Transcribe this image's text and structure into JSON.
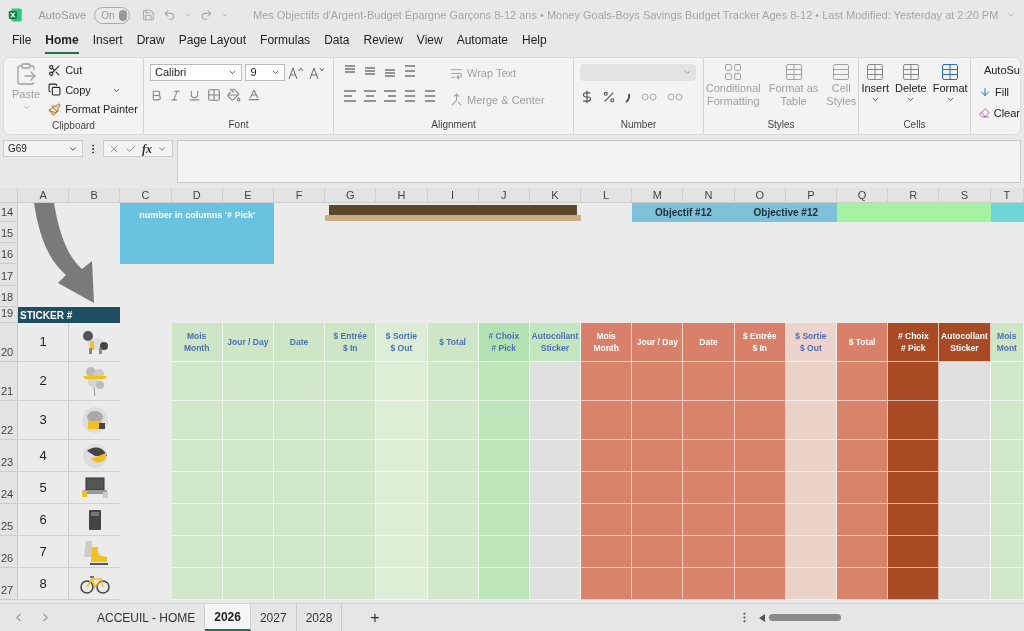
{
  "title_bar": {
    "autosave_label": "AutoSave",
    "autosave": {
      "label": "On",
      "on": true
    },
    "title": "Mes Objectifs d'Argent-Budget Épargne Garçons 8-12 ans • Money Goals-Boys Savings Budget Tracker Ages 8-12 • Last Modified: Yesterday at 2:20 PM"
  },
  "menu_tabs": [
    {
      "label": "File",
      "selected": false
    },
    {
      "label": "Home",
      "selected": true
    },
    {
      "label": "Insert",
      "selected": false
    },
    {
      "label": "Draw",
      "selected": false
    },
    {
      "label": "Page Layout",
      "selected": false
    },
    {
      "label": "Formulas",
      "selected": false
    },
    {
      "label": "Data",
      "selected": false
    },
    {
      "label": "Review",
      "selected": false
    },
    {
      "label": "View",
      "selected": false
    },
    {
      "label": "Automate",
      "selected": false
    },
    {
      "label": "Help",
      "selected": false
    }
  ],
  "ribbon": {
    "clipboard": {
      "paste": {
        "label": "Paste",
        "disabled": true
      },
      "cut": {
        "label": "Cut",
        "disabled": false
      },
      "copy": {
        "label": "Copy",
        "disabled": false
      },
      "format_painter": {
        "label": "Format Painter",
        "disabled": false
      },
      "label": "Clipboard"
    },
    "font": {
      "name": "Calibri",
      "size": "9",
      "label": "Font"
    },
    "alignment": {
      "wrap_text": {
        "label": "Wrap Text",
        "disabled": true
      },
      "merge": {
        "label": "Merge & Center",
        "disabled": true
      },
      "label": "Alignment"
    },
    "number": {
      "label": "Number"
    },
    "styles": {
      "items": [
        {
          "lines": [
            "Conditional",
            "Formatting"
          ],
          "disabled": true
        },
        {
          "lines": [
            "Format as",
            "Table"
          ],
          "disabled": true
        },
        {
          "lines": [
            "Cell",
            "Styles"
          ],
          "disabled": true
        }
      ],
      "label": "Styles"
    },
    "cells": {
      "items": [
        {
          "label": "Insert"
        },
        {
          "label": "Delete"
        },
        {
          "label": "Format"
        }
      ],
      "label": "Cells"
    },
    "editing": {
      "items": [
        {
          "label": "AutoSu"
        },
        {
          "label": "Fill"
        },
        {
          "label": "Clear"
        }
      ]
    }
  },
  "formula_bar": {
    "name_box": "G69",
    "fx": "fx"
  },
  "sheet": {
    "columns": [
      "A",
      "B",
      "C",
      "D",
      "E",
      "F",
      "G",
      "H",
      "I",
      "J",
      "K",
      "L",
      "M",
      "N",
      "O",
      "P",
      "Q",
      "R",
      "S",
      "T"
    ],
    "rows": [
      "14",
      "15",
      "16",
      "17",
      "18",
      "19",
      "20",
      "21",
      "22",
      "23",
      "24",
      "25",
      "26",
      "27"
    ],
    "note": "number in columns '# Pick'",
    "goal_labels": [
      "Objectif #12",
      "Objective #12"
    ],
    "sticker_header": "STICKER #",
    "stickers": [
      {
        "number": "1",
        "kind": "horse"
      },
      {
        "number": "2",
        "kind": "balloons"
      },
      {
        "number": "3",
        "kind": "cupcake"
      },
      {
        "number": "4",
        "kind": "ball"
      },
      {
        "number": "5",
        "kind": "laptop"
      },
      {
        "number": "6",
        "kind": "phone"
      },
      {
        "number": "7",
        "kind": "skates"
      },
      {
        "number": "8",
        "kind": "bike"
      }
    ],
    "table_groups": [
      {
        "kind": "green",
        "columns": [
          {
            "lines": [
              "Mois",
              "Month"
            ],
            "kind": "base"
          },
          {
            "lines": [
              "Jour / Day"
            ],
            "kind": "base"
          },
          {
            "lines": [
              "Date"
            ],
            "kind": "base"
          },
          {
            "lines": [
              "$ Entrée",
              "$ In"
            ],
            "kind": "base"
          },
          {
            "lines": [
              "$ Sortie",
              "$ Out"
            ],
            "kind": "light"
          },
          {
            "lines": [
              "$ Total"
            ],
            "kind": "base"
          },
          {
            "lines": [
              "# Choix",
              "# Pick"
            ],
            "kind": "pick"
          },
          {
            "lines": [
              "Autocollant",
              "Sticker"
            ],
            "kind": "sticker"
          }
        ]
      },
      {
        "kind": "orange",
        "columns": [
          {
            "lines": [
              "Mois",
              "Month"
            ],
            "kind": "base"
          },
          {
            "lines": [
              "Jour / Day"
            ],
            "kind": "base"
          },
          {
            "lines": [
              "Date"
            ],
            "kind": "base"
          },
          {
            "lines": [
              "$ Entrée",
              "$ In"
            ],
            "kind": "base"
          },
          {
            "lines": [
              "$ Sortie",
              "$ Out"
            ],
            "kind": "light"
          },
          {
            "lines": [
              "$ Total"
            ],
            "kind": "base"
          },
          {
            "lines": [
              "# Choix",
              "# Pick"
            ],
            "kind": "pick"
          },
          {
            "lines": [
              "Autocollant",
              "Sticker"
            ],
            "kind": "sticker"
          }
        ]
      },
      {
        "kind": "green",
        "columns": [
          {
            "lines": [
              "Mois",
              "Mont"
            ],
            "kind": "base"
          }
        ]
      }
    ]
  },
  "sheet_tabs": [
    {
      "label": "ACCEUIL - HOME",
      "selected": false
    },
    {
      "label": "2026",
      "selected": true
    },
    {
      "label": "2027",
      "selected": false
    },
    {
      "label": "2028",
      "selected": false
    }
  ],
  "add_sheet": "+"
}
